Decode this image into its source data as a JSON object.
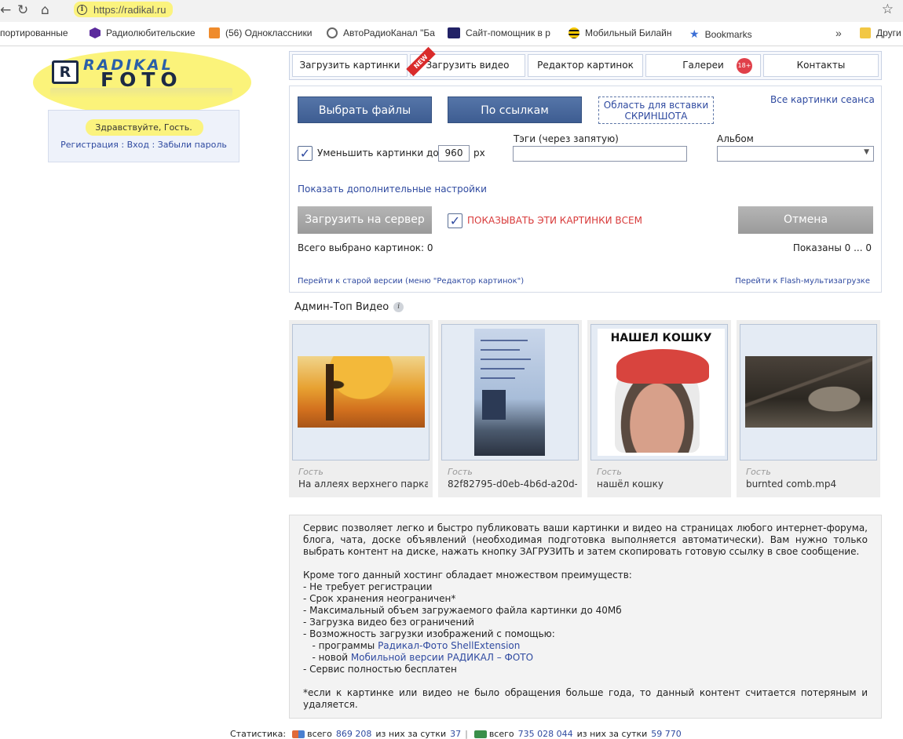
{
  "browser": {
    "url": "https://radikal.ru",
    "bookmarks": [
      {
        "label": "портированные",
        "icon": "folder-icon",
        "color": "#f2c744"
      },
      {
        "label": "Радиолюбительские",
        "icon": "hex-icon",
        "color": "#5b2a9c"
      },
      {
        "label": "(56) Одноклассники",
        "icon": "mail-icon",
        "color": "#ef8b2c"
      },
      {
        "label": "АвтоРадиоКанал \"Ба",
        "icon": "radio-icon",
        "color": "#555555"
      },
      {
        "label": "Сайт-помощник в р",
        "icon": "aud-icon",
        "color": "#222266"
      },
      {
        "label": "Мобильный Билайн",
        "icon": "beeline-icon",
        "color": "#f6c700"
      },
      {
        "label": "Bookmarks",
        "icon": "star-icon",
        "color": "#3b6fd6"
      },
      {
        "label": "Други",
        "icon": "folder-icon",
        "color": "#f2c744"
      }
    ],
    "more": "»"
  },
  "logo": {
    "r": "R",
    "top": "RADIKAL",
    "bottom": "FOTO"
  },
  "guest": {
    "greeting": "Здравствуйте, Гость.",
    "register": "Регистрация",
    "login": "Вход",
    "forgot": "Забыли пароль",
    "sep": " : "
  },
  "tabs": [
    {
      "label": "Загрузить картинки"
    },
    {
      "label": "Загрузить видео",
      "badge": "NEW"
    },
    {
      "label": "Редактор картинок"
    },
    {
      "label": "Галереи",
      "badge": "18+"
    },
    {
      "label": "Контакты"
    }
  ],
  "upload": {
    "choose_files": "Выбрать файлы",
    "by_links": "По ссылкам",
    "paste_line1": "Область для вставки",
    "paste_line2": "СКРИНШОТА",
    "all_session": "Все картинки сеанса",
    "shrink_label": "Уменьшить картинки до",
    "shrink_value": "960",
    "shrink_unit": "px",
    "tags_label": "Тэги (через запятую)",
    "album_label": "Альбом",
    "more_settings": "Показать дополнительные настройки",
    "upload_btn": "Загрузить на сервер",
    "show_all": "ПОКАЗЫВАТЬ ЭТИ КАРТИНКИ ВСЕМ",
    "cancel": "Отмена",
    "total_selected": "Всего выбрано картинок: 0",
    "shown": "Показаны 0 ... 0",
    "old_version": "Перейти к старой версии (меню \"Редактор картинок\")",
    "flash_upload": "Перейти к Flash-мультизагрузке"
  },
  "admin_top": {
    "title": "Админ-Топ Видео",
    "cards": [
      {
        "author": "Гость",
        "title": "На аллеях верхнего парка"
      },
      {
        "author": "Гость",
        "title": "82f82795-d0eb-4b6d-a20d-"
      },
      {
        "author": "Гость",
        "title": "нашёл кошку",
        "overlay": "НАШЕЛ КОШКУ"
      },
      {
        "author": "Гость",
        "title": "burnted comb.mp4"
      }
    ]
  },
  "description": {
    "p1": "Сервис позволяет легко и быстро публиковать ваши картинки и видео на страницах любого интернет-форума, блога, чата, доске объявлений (необходимая подготовка выполняется автоматически). Вам нужно только выбрать контент на диске, нажать кнопку ЗАГРУЗИТЬ и затем скопировать готовую ссылку в свое сообщение.",
    "p2": "Кроме того данный хостинг обладает множеством преимуществ:",
    "items": [
      "- Не требует регистрации",
      "- Срок хранения неограничен*",
      "- Максимальный объем загружаемого файла картинки до 40Мб",
      "- Загрузка видео без ограничений",
      "- Возможность загрузки изображений с помощью:"
    ],
    "sub1_prefix": "   - программы ",
    "sub1_link": "Радикал-Фото ShellExtension",
    "sub2_prefix": "   - новой ",
    "sub2_link": "Мобильной версии РАДИКАЛ – ФОТО",
    "last_item": "- Сервис полностью бесплатен",
    "footnote": "*если к картинке или видео не было обращения больше года, то данный контент считается потеряным и удаляется."
  },
  "stats": {
    "label": "Статистика:",
    "users_total_label": "всего",
    "users_total": "869 208",
    "users_day_label": "из них за сутки",
    "users_day": "37",
    "sep": "|",
    "files_total_label": "всего",
    "files_total": "735 028 044",
    "files_day_label": "из них за сутки",
    "files_day": "59 770"
  }
}
